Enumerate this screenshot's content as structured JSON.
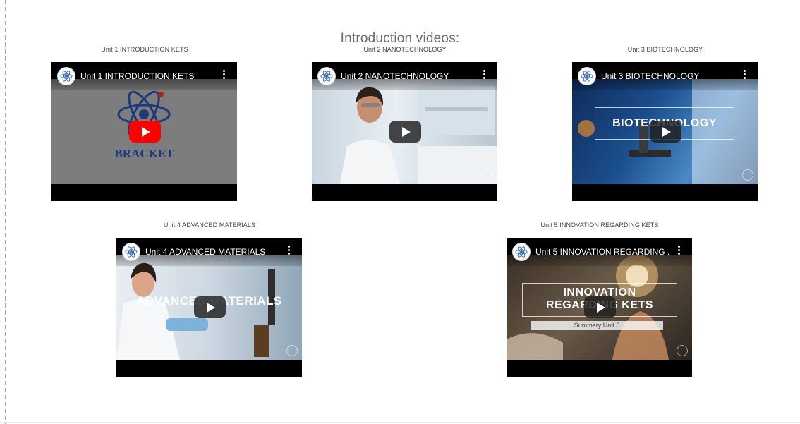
{
  "page": {
    "heading": "Introduction videos:"
  },
  "videos": [
    {
      "caption": "Unit 1 INTRODUCTION KETS",
      "title": "Unit 1 INTRODUCTION KETS",
      "thumb_text": "BRACKET",
      "play_style": "red"
    },
    {
      "caption": "Unit 2 NANOTECHNOLOGY",
      "title": "Unit 2 NANOTECHNOLOGY",
      "play_style": "dark"
    },
    {
      "caption": "Unit 3 BIOTECHNOLOGY",
      "title": "Unit 3 BIOTECHNOLOGY",
      "thumb_text": "BIOTECHNOLOGY",
      "play_style": "dark"
    },
    {
      "caption": "Unit 4 ADVANCED MATERIALS",
      "title": "Unit 4 ADVANCED MATERIALS",
      "thumb_text": "ADVANCED MATERIALS",
      "play_style": "dark"
    },
    {
      "caption": "Unit 5 INNOVATION REGARDING KETS",
      "title": "Unit 5 INNOVATION REGARDING ...",
      "thumb_text": "INNOVATION",
      "thumb_text2": "REGARDING KETS",
      "thumb_sub": "Summary Unit 5",
      "play_style": "dark"
    }
  ],
  "icons": {
    "play": "play-icon",
    "menu": "more-vert-icon",
    "channel": "channel-atom-logo-icon"
  },
  "colors": {
    "youtube_red": "#ff0000",
    "bracket_blue": "#1f3a7a",
    "bracket_red": "#b01c22"
  }
}
